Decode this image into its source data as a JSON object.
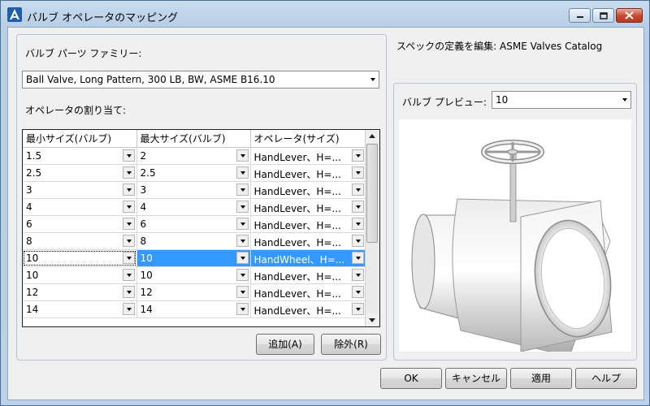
{
  "window": {
    "title": "バルブ オペレータのマッピング"
  },
  "left": {
    "family_label": "バルブ パーツ ファミリー:",
    "family_value": "Ball Valve, Long Pattern, 300 LB, BW, ASME B16.10",
    "assign_label": "オペレータの割り当て:",
    "table": {
      "columns": [
        "最小サイズ(バルブ)",
        "最大サイズ(バルブ)",
        "オペレータ(サイズ)"
      ],
      "rows": [
        {
          "min": "1.5",
          "max": "2",
          "op": "HandLever、H=..."
        },
        {
          "min": "2.5",
          "max": "2.5",
          "op": "HandLever、H=..."
        },
        {
          "min": "3",
          "max": "3",
          "op": "HandLever、H=..."
        },
        {
          "min": "4",
          "max": "4",
          "op": "HandLever、H=..."
        },
        {
          "min": "6",
          "max": "6",
          "op": "HandLever、H=..."
        },
        {
          "min": "8",
          "max": "8",
          "op": "HandLever、H=..."
        },
        {
          "min": "10",
          "max": "10",
          "op": "HandWheel、H=..."
        },
        {
          "min": "10",
          "max": "10",
          "op": "HandLever、H=..."
        },
        {
          "min": "12",
          "max": "12",
          "op": "HandLever、H=..."
        },
        {
          "min": "14",
          "max": "14",
          "op": "HandLever、H=..."
        }
      ],
      "selected_row": 6
    },
    "add_button": "追加(A)",
    "remove_button": "除外(R)"
  },
  "right": {
    "spec_edit_label": "スペックの定義を編集: ASME Valves Catalog",
    "preview_label": "バルブ プレビュー:",
    "preview_size": "10"
  },
  "buttons": {
    "ok": "OK",
    "cancel": "キャンセル",
    "apply": "適用",
    "help": "ヘルプ"
  },
  "colors": {
    "selection": "#3399ff",
    "title_bg": "#c4d8ee"
  }
}
